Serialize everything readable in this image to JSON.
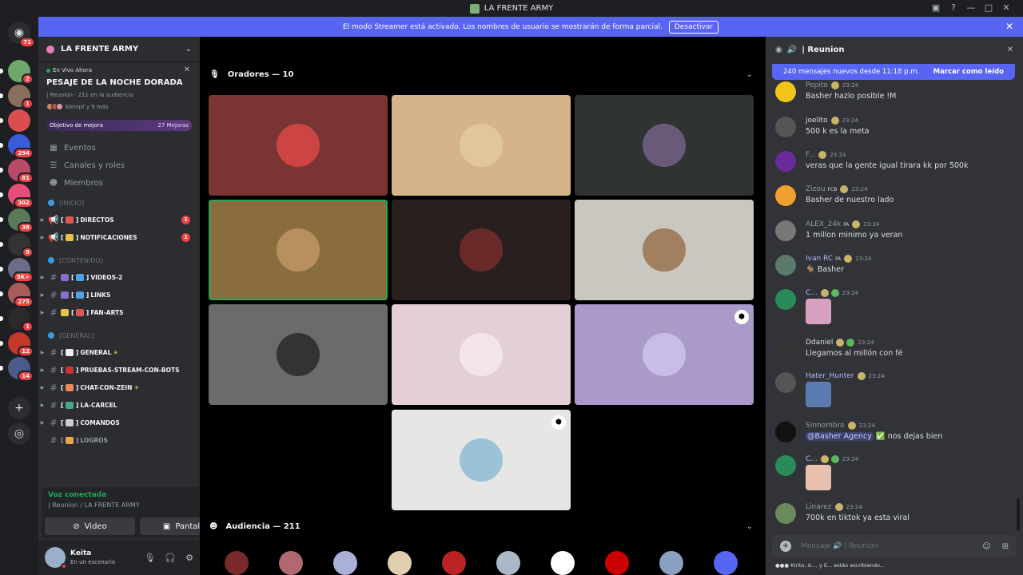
{
  "window": {
    "title": "LA FRENTE ARMY"
  },
  "banner": {
    "text": "El modo Streamer está activado. Los nombres de usuario se mostrarán de forma parcial.",
    "button": "Desactivar"
  },
  "rail": {
    "home_badge": "71",
    "servers": [
      {
        "badge": "2",
        "color": "#6ea96b"
      },
      {
        "badge": "1",
        "color": "#8a6f5c"
      },
      {
        "badge": "",
        "color": "#d94f4f"
      },
      {
        "badge": "294",
        "color": "#3b5bdb"
      },
      {
        "badge": "81",
        "color": "#b94a6a"
      },
      {
        "badge": "302",
        "color": "#e84c7b"
      },
      {
        "badge": "38",
        "color": "#5a7a5a"
      },
      {
        "badge": "9",
        "color": "#333333"
      },
      {
        "badge": "5K+",
        "color": "#6c6c8a"
      },
      {
        "badge": "275",
        "color": "#a85d5d"
      },
      {
        "badge": "1",
        "color": "#2a2a2a"
      },
      {
        "badge": "12",
        "color": "#c0392b"
      },
      {
        "badge": "14",
        "color": "#4a5a8a"
      }
    ]
  },
  "server": {
    "name": "LA FRENTE ARMY"
  },
  "live_event": {
    "label": "En Vivo Ahora",
    "title": "PESAJE DE LA NOCHE DORADA",
    "meta": "| Reunion · 211 en la audiencia",
    "users": "kleinpf y 9 más"
  },
  "boost": {
    "label": "Objetivo de mejora",
    "count": "27 Mejoras"
  },
  "nav": [
    {
      "icon": "calendar-icon",
      "label": "Eventos"
    },
    {
      "icon": "channels-icon",
      "label": "Canales y roles"
    },
    {
      "icon": "members-icon",
      "label": "Miembros"
    }
  ],
  "categories": {
    "inicio": "[INICIO]",
    "contenido": "[CONTENIDO]",
    "general": "[GENERAL]"
  },
  "channels": {
    "directos": {
      "name": "DIRECTOS",
      "count": "1"
    },
    "notificaciones": {
      "name": "NOTIFICACIONES",
      "count": "1"
    },
    "videos": {
      "name": "VIDEOS-2"
    },
    "links": {
      "name": "LINKS"
    },
    "fanarts": {
      "name": "FAN-ARTS"
    },
    "general": {
      "name": "GENERAL"
    },
    "pruebas": {
      "name": "PRUEBAS-STREAM-CON-BOTS"
    },
    "chatzein": {
      "name": "CHAT-CON-ZEIN"
    },
    "carcel": {
      "name": "LA-CARCEL"
    },
    "comandos": {
      "name": "COMANDOS"
    },
    "logros": {
      "name": "LOGROS"
    }
  },
  "voice": {
    "status": "Voz conectada",
    "location": "| Reunion / LA FRENTE ARMY",
    "video_label": "Video",
    "screen_label": "Pantalla"
  },
  "user": {
    "name": "Keita",
    "status": "En un escenario"
  },
  "stage": {
    "speakers_header": "Oradores — 10",
    "audience_header": "Audiencia — 211",
    "tiles": [
      {
        "bg": "#7a3434",
        "av": "#c44"
      },
      {
        "bg": "#d6b48a",
        "av": "#e0c79a"
      },
      {
        "bg": "#2f3432",
        "av": "#6a5a7a"
      },
      {
        "bg": "#8a6d3f",
        "av": "#b89060"
      },
      {
        "bg": "#2a1f1f",
        "av": "#6a2a2a"
      },
      {
        "bg": "#c9c7c0",
        "av": "#a08060"
      },
      {
        "bg": "#6b6b6b",
        "av": "#333"
      },
      {
        "bg": "#e3cfd6",
        "av": "#f3e6ea"
      },
      {
        "bg": "#a99ac9",
        "av": "#c9bde6"
      },
      {
        "bg": "#e6e6e6",
        "av": "#9cc2d8"
      }
    ],
    "audience_colors": [
      "#7a2a2a",
      "#b0696f",
      "#aab0d8",
      "#e0d0b0",
      "#b22",
      "#aab8c8",
      "#fff",
      "#c00",
      "#8aa0c0",
      "#5865f2"
    ]
  },
  "chat": {
    "title": "| Reunion",
    "new_messages": "240 mensajes nuevos desde 11:18 p.m.",
    "mark_read": "Marcar como leído",
    "messages": [
      {
        "name": "Pepito",
        "time": "23:24",
        "text": "Basher hazlo posible !M",
        "color": "#949ba4",
        "av": "#f0c419"
      },
      {
        "name": "joelito",
        "time": "23:24",
        "text": "500 k es la meta",
        "color": "#dbdee1",
        "av": "#555"
      },
      {
        "name": "F...",
        "time": "23:24",
        "text": "veras que la gente igual tirara kk por 500k",
        "color": "#949ba4",
        "av": "#6a2a9a"
      },
      {
        "name": "Zizou",
        "tag": "FCB",
        "time": "23:24",
        "text": "Basher de nuestro lado",
        "color": "#949ba4",
        "av": "#f0a030"
      },
      {
        "name": "ALEX_24k",
        "tag": "FA",
        "time": "23:24",
        "text": "1 millon minimo ya veran",
        "color": "#949ba4",
        "av": "#777"
      },
      {
        "name": "Ivan RC",
        "tag": "FA",
        "time": "23:24",
        "text": "Basher",
        "color": "#b9bbff",
        "av": "#5a7a6a"
      },
      {
        "name": "C...",
        "time": "23:24",
        "color": "#b9bbff",
        "av": "#2a8a5a"
      },
      {
        "name": "Ddaniel",
        "time": "23:24",
        "text": "Llegamos al millón con fé",
        "color": "#dbdee1",
        "av": "#333"
      },
      {
        "name": "Hater_Hunter",
        "time": "23:24",
        "color": "#b9bbff",
        "av": "#555"
      },
      {
        "name": "Sinnombre",
        "time": "23:24",
        "mention": "@Basher Agency",
        "text": "nos dejas bien",
        "color": "#949ba4",
        "av": "#111"
      },
      {
        "name": "C...",
        "time": "23:24",
        "color": "#b9bbff",
        "av": "#2a8a5a"
      },
      {
        "name": "Linarez",
        "time": "23:24",
        "text": "700k en tiktok ya esta viral",
        "color": "#949ba4",
        "av": "#6a8a5a"
      }
    ],
    "input_placeholder": "Mensaje  🔊  | Reunion",
    "typing": "Kirito, d..., y E... están escribiendo..."
  }
}
